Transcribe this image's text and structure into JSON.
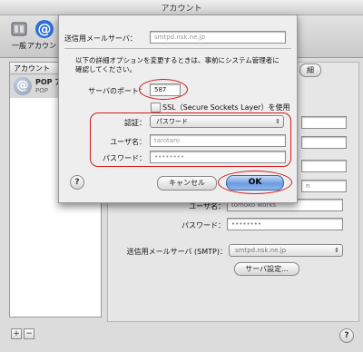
{
  "window": {
    "title": "アカウント"
  },
  "toolbar": {
    "items": [
      {
        "label": "一般",
        "icon": "switch-icon"
      },
      {
        "label": "アカウント",
        "icon": "at-icon"
      }
    ]
  },
  "accounts": {
    "header": "アカウント",
    "items": [
      {
        "name": "POP ア",
        "type": "POP"
      }
    ],
    "add_symbol": "+",
    "remove_symbol": "−"
  },
  "panel": {
    "tab_fragment": "細",
    "username_label": "ユーザ名：",
    "username_value": "tomoko works",
    "password_label": "パスワード：",
    "password_value": "••••••••",
    "smtp_label": "送信用メールサーバ (SMTP)：",
    "smtp_value": "smtpd.nsk.ne.jp",
    "server_settings_button": "サーバ設定...",
    "field_fragment_1": "n"
  },
  "sheet": {
    "server_label": "送信用メールサーバ：",
    "server_value": "smtpd.nsk.ne.jp",
    "description": "以下の詳細オプションを変更するときは、事前にシステム管理者に確認してください。",
    "port_label": "サーバのポート：",
    "port_value": "587",
    "ssl_label": "SSL（Secure Sockets Layer）を使用",
    "auth_label": "認証：",
    "auth_value": "パスワード",
    "username_label": "ユーザ名：",
    "username_value": "tarotaro",
    "password_label": "パスワード：",
    "password_value": "••••••••",
    "cancel_button": "キャンセル",
    "ok_button": "OK"
  },
  "help_symbol": "?",
  "colors": {
    "annotation_red": "#d21a1a",
    "default_button_blue": "#6d9be0"
  }
}
